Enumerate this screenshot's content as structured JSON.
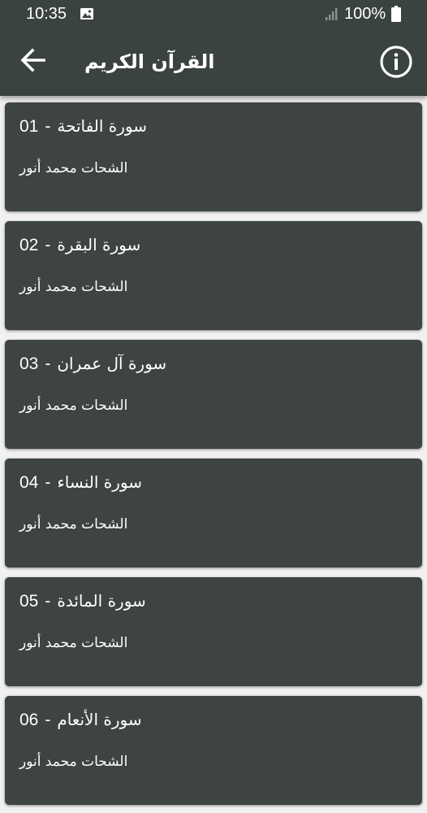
{
  "status_bar": {
    "time": "10:35",
    "battery": "100%",
    "icons": [
      "image-icon",
      "signal-icon",
      "battery-icon"
    ]
  },
  "app_bar": {
    "title": "القرآن الكريم",
    "back_icon": "arrow-left-icon",
    "info_icon": "info-circle-icon"
  },
  "colors": {
    "app_bar": "#3b4341",
    "card": "#3d4442",
    "background": "#f1f1f1",
    "text": "#ffffff"
  },
  "surahs": [
    {
      "num": "01",
      "name": "سورة الفاتحة",
      "reciter": "الشحات محمد أنور"
    },
    {
      "num": "02",
      "name": "سورة البقرة",
      "reciter": "الشحات محمد أنور"
    },
    {
      "num": "03",
      "name": "سورة آل عمران",
      "reciter": "الشحات محمد أنور"
    },
    {
      "num": "04",
      "name": "سورة النساء",
      "reciter": "الشحات محمد أنور"
    },
    {
      "num": "05",
      "name": "سورة المائدة",
      "reciter": "الشحات محمد أنور"
    },
    {
      "num": "06",
      "name": "سورة الأنعام",
      "reciter": "الشحات محمد أنور"
    }
  ]
}
